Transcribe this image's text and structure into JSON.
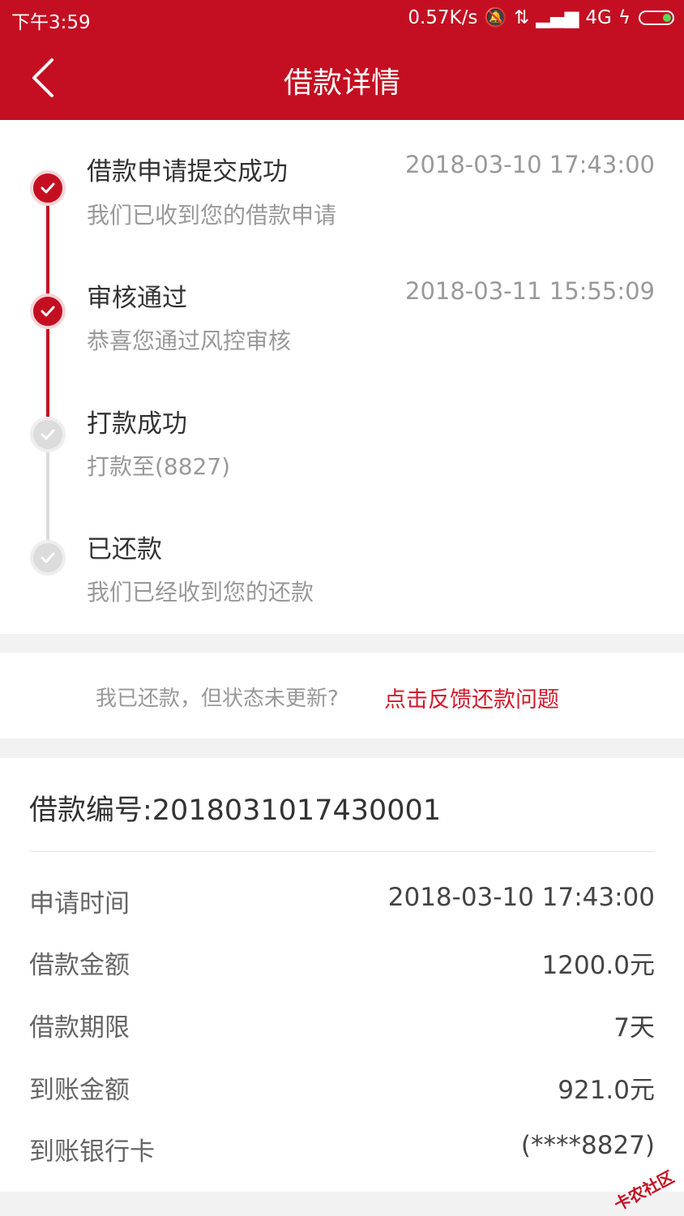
{
  "status_bar": {
    "time": "下午3:59",
    "net_speed": "0.57K/s",
    "network": "4G"
  },
  "header": {
    "title": "借款详情",
    "back_icon": "chevron-left-icon"
  },
  "timeline": {
    "steps": [
      {
        "title": "借款申请提交成功",
        "time": "2018-03-10 17:43:00",
        "desc": "我们已收到您的借款申请",
        "status": "done"
      },
      {
        "title": "审核通过",
        "time": "2018-03-11 15:55:09",
        "desc": "恭喜您通过风控审核",
        "status": "done"
      },
      {
        "title": "打款成功",
        "time": "",
        "desc": "打款至(8827)",
        "status": "pending"
      },
      {
        "title": "已还款",
        "time": "",
        "desc": "我们已经收到您的还款",
        "status": "pending"
      }
    ]
  },
  "feedback": {
    "question": "我已还款，但状态未更新?",
    "link": "点击反馈还款问题"
  },
  "details": {
    "loan_number": "借款编号:2018031017430001",
    "rows": [
      {
        "label": "申请时间",
        "value": "2018-03-10 17:43:00"
      },
      {
        "label": "借款金额",
        "value": "1200.0元"
      },
      {
        "label": "借款期限",
        "value": "7天"
      },
      {
        "label": "到账金额",
        "value": "921.0元"
      },
      {
        "label": "到账银行卡",
        "value": "(****8827)"
      }
    ]
  },
  "watermark": "卡农社区",
  "colors": {
    "primary": "#c40f22",
    "pending": "#dcdcdc",
    "link": "#d01a2b"
  }
}
